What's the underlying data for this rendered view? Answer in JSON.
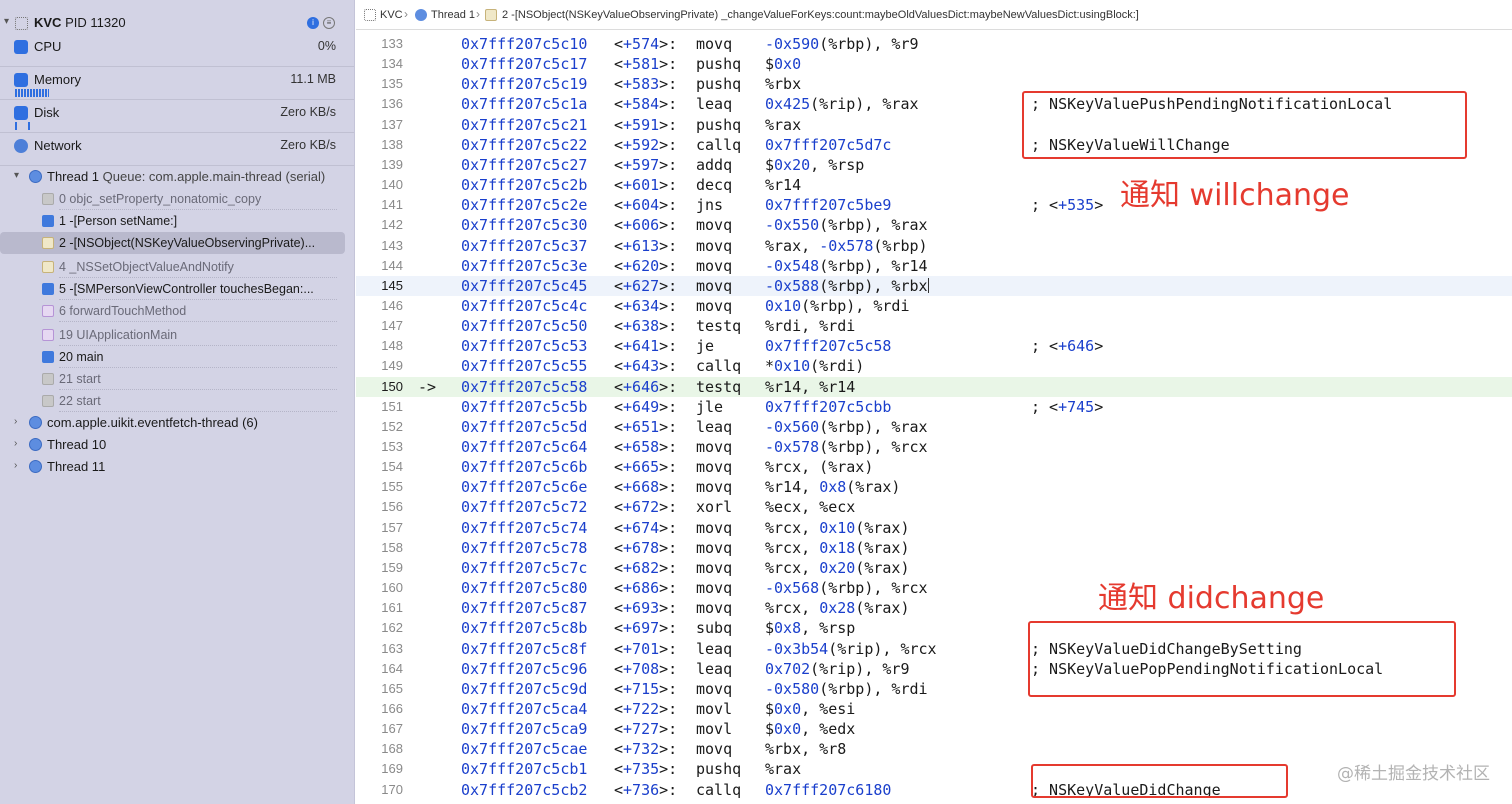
{
  "sidebar": {
    "process": {
      "name": "KVC",
      "pid": "PID 11320"
    },
    "gauges": [
      {
        "label": "CPU",
        "value": "0%",
        "icon": "cpu-icon"
      },
      {
        "label": "Memory",
        "value": "11.1 MB",
        "icon": "memory-icon"
      },
      {
        "label": "Disk",
        "value": "Zero KB/s",
        "icon": "disk-icon"
      },
      {
        "label": "Network",
        "value": "Zero KB/s",
        "icon": "network-icon"
      }
    ],
    "thread1": {
      "name": "Thread 1",
      "queue": "Queue: com.apple.main-thread (serial)"
    },
    "frames": [
      {
        "label": "0 objc_setProperty_nonatomic_copy",
        "icon": "gear",
        "style": "gray"
      },
      {
        "label": "1 -[Person setName:]",
        "icon": "user",
        "style": "dark"
      },
      {
        "label": "2 -[NSObject(NSKeyValueObservingPrivate)...",
        "icon": "file",
        "style": "dark",
        "selected": true
      },
      {
        "label": "4 _NSSetObjectValueAndNotify",
        "icon": "file",
        "style": "gray"
      },
      {
        "label": "5 -[SMPersonViewController touchesBegan:...",
        "icon": "user",
        "style": "dark"
      },
      {
        "label": "6 forwardTouchMethod",
        "icon": "purple",
        "style": "gray"
      },
      {
        "label": "19 UIApplicationMain",
        "icon": "purple",
        "style": "gray"
      },
      {
        "label": "20 main",
        "icon": "user",
        "style": "dark"
      },
      {
        "label": "21 start",
        "icon": "gear",
        "style": "gray"
      },
      {
        "label": "22 start",
        "icon": "gear",
        "style": "gray"
      }
    ],
    "other_threads": [
      "com.apple.uikit.eventfetch-thread (6)",
      "Thread 10",
      "Thread 11"
    ]
  },
  "breadcrumb": {
    "app": "KVC",
    "thread": "Thread 1",
    "frame": "2 -[NSObject(NSKeyValueObservingPrivate) _changeValueForKeys:count:maybeOldValuesDict:maybeNewValuesDict:usingBlock:]"
  },
  "code": {
    "current_line": 145,
    "pc_line": 150,
    "lines": [
      {
        "n": "133",
        "addr": "0x7fff207c5c10",
        "off": "+574",
        "op": "movq",
        "args": "-0x590(%rbp), %r9",
        "cmt": ""
      },
      {
        "n": "134",
        "addr": "0x7fff207c5c17",
        "off": "+581",
        "op": "pushq",
        "args": "$0x0",
        "cmt": ""
      },
      {
        "n": "135",
        "addr": "0x7fff207c5c19",
        "off": "+583",
        "op": "pushq",
        "args": "%rbx",
        "cmt": ""
      },
      {
        "n": "136",
        "addr": "0x7fff207c5c1a",
        "off": "+584",
        "op": "leaq",
        "args": "0x425(%rip), %rax",
        "cmt": "; NSKeyValuePushPendingNotificationLocal"
      },
      {
        "n": "137",
        "addr": "0x7fff207c5c21",
        "off": "+591",
        "op": "pushq",
        "args": "%rax",
        "cmt": ""
      },
      {
        "n": "138",
        "addr": "0x7fff207c5c22",
        "off": "+592",
        "op": "callq",
        "args": "0x7fff207c5d7c",
        "cmt": "; NSKeyValueWillChange"
      },
      {
        "n": "139",
        "addr": "0x7fff207c5c27",
        "off": "+597",
        "op": "addq",
        "args": "$0x20, %rsp",
        "cmt": ""
      },
      {
        "n": "140",
        "addr": "0x7fff207c5c2b",
        "off": "+601",
        "op": "decq",
        "args": "%r14",
        "cmt": ""
      },
      {
        "n": "141",
        "addr": "0x7fff207c5c2e",
        "off": "+604",
        "op": "jns",
        "args": "0x7fff207c5be9",
        "cmt": "; <+535>"
      },
      {
        "n": "142",
        "addr": "0x7fff207c5c30",
        "off": "+606",
        "op": "movq",
        "args": "-0x550(%rbp), %rax",
        "cmt": ""
      },
      {
        "n": "143",
        "addr": "0x7fff207c5c37",
        "off": "+613",
        "op": "movq",
        "args": "%rax, -0x578(%rbp)",
        "cmt": ""
      },
      {
        "n": "144",
        "addr": "0x7fff207c5c3e",
        "off": "+620",
        "op": "movq",
        "args": "-0x548(%rbp), %r14",
        "cmt": ""
      },
      {
        "n": "145",
        "addr": "0x7fff207c5c45",
        "off": "+627",
        "op": "movq",
        "args": "-0x588(%rbp), %rbx",
        "cmt": ""
      },
      {
        "n": "146",
        "addr": "0x7fff207c5c4c",
        "off": "+634",
        "op": "movq",
        "args": "0x10(%rbp), %rdi",
        "cmt": ""
      },
      {
        "n": "147",
        "addr": "0x7fff207c5c50",
        "off": "+638",
        "op": "testq",
        "args": "%rdi, %rdi",
        "cmt": ""
      },
      {
        "n": "148",
        "addr": "0x7fff207c5c53",
        "off": "+641",
        "op": "je",
        "args": "0x7fff207c5c58",
        "cmt": "; <+646>"
      },
      {
        "n": "149",
        "addr": "0x7fff207c5c55",
        "off": "+643",
        "op": "callq",
        "args": "*0x10(%rdi)",
        "cmt": ""
      },
      {
        "n": "150",
        "addr": "0x7fff207c5c58",
        "off": "+646",
        "op": "testq",
        "args": "%r14, %r14",
        "cmt": "",
        "arrow": "->"
      },
      {
        "n": "151",
        "addr": "0x7fff207c5c5b",
        "off": "+649",
        "op": "jle",
        "args": "0x7fff207c5cbb",
        "cmt": "; <+745>"
      },
      {
        "n": "152",
        "addr": "0x7fff207c5c5d",
        "off": "+651",
        "op": "leaq",
        "args": "-0x560(%rbp), %rax",
        "cmt": ""
      },
      {
        "n": "153",
        "addr": "0x7fff207c5c64",
        "off": "+658",
        "op": "movq",
        "args": "-0x578(%rbp), %rcx",
        "cmt": ""
      },
      {
        "n": "154",
        "addr": "0x7fff207c5c6b",
        "off": "+665",
        "op": "movq",
        "args": "%rcx, (%rax)",
        "cmt": ""
      },
      {
        "n": "155",
        "addr": "0x7fff207c5c6e",
        "off": "+668",
        "op": "movq",
        "args": "%r14, 0x8(%rax)",
        "cmt": ""
      },
      {
        "n": "156",
        "addr": "0x7fff207c5c72",
        "off": "+672",
        "op": "xorl",
        "args": "%ecx, %ecx",
        "cmt": ""
      },
      {
        "n": "157",
        "addr": "0x7fff207c5c74",
        "off": "+674",
        "op": "movq",
        "args": "%rcx, 0x10(%rax)",
        "cmt": ""
      },
      {
        "n": "158",
        "addr": "0x7fff207c5c78",
        "off": "+678",
        "op": "movq",
        "args": "%rcx, 0x18(%rax)",
        "cmt": ""
      },
      {
        "n": "159",
        "addr": "0x7fff207c5c7c",
        "off": "+682",
        "op": "movq",
        "args": "%rcx, 0x20(%rax)",
        "cmt": ""
      },
      {
        "n": "160",
        "addr": "0x7fff207c5c80",
        "off": "+686",
        "op": "movq",
        "args": "-0x568(%rbp), %rcx",
        "cmt": ""
      },
      {
        "n": "161",
        "addr": "0x7fff207c5c87",
        "off": "+693",
        "op": "movq",
        "args": "%rcx, 0x28(%rax)",
        "cmt": ""
      },
      {
        "n": "162",
        "addr": "0x7fff207c5c8b",
        "off": "+697",
        "op": "subq",
        "args": "$0x8, %rsp",
        "cmt": ""
      },
      {
        "n": "163",
        "addr": "0x7fff207c5c8f",
        "off": "+701",
        "op": "leaq",
        "args": "-0x3b54(%rip), %rcx",
        "cmt": "; NSKeyValueDidChangeBySetting"
      },
      {
        "n": "164",
        "addr": "0x7fff207c5c96",
        "off": "+708",
        "op": "leaq",
        "args": "0x702(%rip), %r9",
        "cmt": "; NSKeyValuePopPendingNotificationLocal"
      },
      {
        "n": "165",
        "addr": "0x7fff207c5c9d",
        "off": "+715",
        "op": "movq",
        "args": "-0x580(%rbp), %rdi",
        "cmt": ""
      },
      {
        "n": "166",
        "addr": "0x7fff207c5ca4",
        "off": "+722",
        "op": "movl",
        "args": "$0x0, %esi",
        "cmt": ""
      },
      {
        "n": "167",
        "addr": "0x7fff207c5ca9",
        "off": "+727",
        "op": "movl",
        "args": "$0x0, %edx",
        "cmt": ""
      },
      {
        "n": "168",
        "addr": "0x7fff207c5cae",
        "off": "+732",
        "op": "movq",
        "args": "%rbx, %r8",
        "cmt": ""
      },
      {
        "n": "169",
        "addr": "0x7fff207c5cb1",
        "off": "+735",
        "op": "pushq",
        "args": "%rax",
        "cmt": ""
      },
      {
        "n": "170",
        "addr": "0x7fff207c5cb2",
        "off": "+736",
        "op": "callq",
        "args": "0x7fff207c6180",
        "cmt": "; NSKeyValueDidChange"
      }
    ]
  },
  "annotations": {
    "willchange": "通知 willchange",
    "didchange": "通知 didchange"
  },
  "watermark": "@稀土掘金技术社区",
  "colors": {
    "address": "#1a3fcc",
    "annotation": "#e53a2f",
    "sidebar_bg": "#d3d3e5",
    "pc_line_bg": "#e9f6e7"
  }
}
